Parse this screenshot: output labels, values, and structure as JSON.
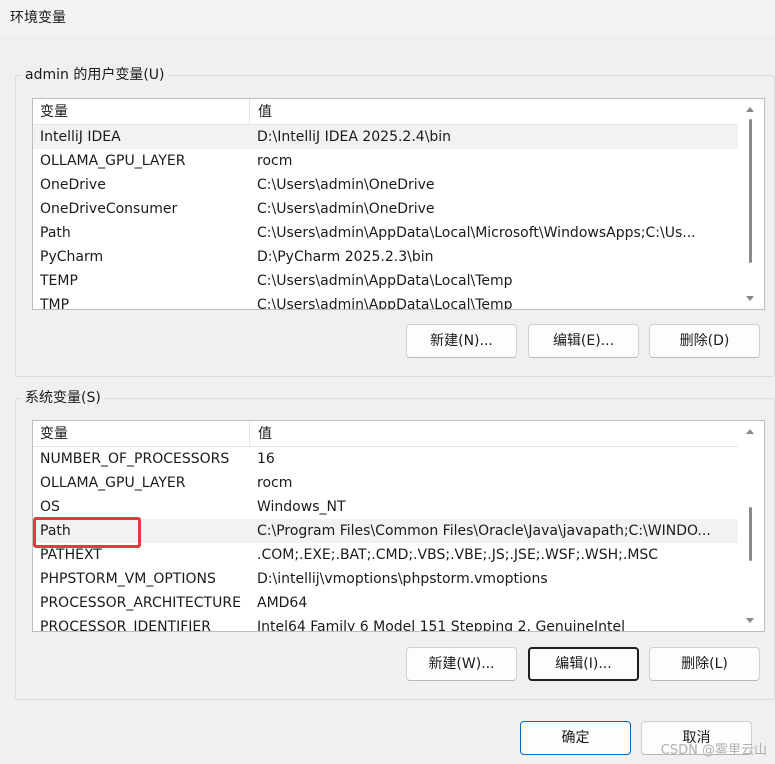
{
  "window": {
    "title": "环境变量"
  },
  "user_vars": {
    "legend": "admin 的用户变量(U)",
    "header": {
      "name": "变量",
      "value": "值"
    },
    "rows": [
      {
        "name": "IntelliJ IDEA",
        "value": "D:\\IntelliJ IDEA 2025.2.4\\bin",
        "selected": true
      },
      {
        "name": "OLLAMA_GPU_LAYER",
        "value": "rocm"
      },
      {
        "name": "OneDrive",
        "value": "C:\\Users\\admin\\OneDrive"
      },
      {
        "name": "OneDriveConsumer",
        "value": "C:\\Users\\admin\\OneDrive"
      },
      {
        "name": "Path",
        "value": "C:\\Users\\admin\\AppData\\Local\\Microsoft\\WindowsApps;C:\\Us..."
      },
      {
        "name": "PyCharm",
        "value": "D:\\PyCharm 2025.2.3\\bin"
      },
      {
        "name": "TEMP",
        "value": "C:\\Users\\admin\\AppData\\Local\\Temp"
      },
      {
        "name": "TMP",
        "value": "C:\\Users\\admin\\AppData\\Local\\Temp"
      }
    ],
    "buttons": {
      "new": "新建(N)...",
      "edit": "编辑(E)...",
      "delete": "删除(D)"
    }
  },
  "system_vars": {
    "legend": "系统变量(S)",
    "header": {
      "name": "变量",
      "value": "值"
    },
    "rows": [
      {
        "name": "NUMBER_OF_PROCESSORS",
        "value": "16"
      },
      {
        "name": "OLLAMA_GPU_LAYER",
        "value": "rocm"
      },
      {
        "name": "OS",
        "value": "Windows_NT"
      },
      {
        "name": "Path",
        "value": "C:\\Program Files\\Common Files\\Oracle\\Java\\javapath;C:\\WINDO...",
        "selected": true,
        "highlighted": true
      },
      {
        "name": "PATHEXT",
        "value": ".COM;.EXE;.BAT;.CMD;.VBS;.VBE;.JS;.JSE;.WSF;.WSH;.MSC"
      },
      {
        "name": "PHPSTORM_VM_OPTIONS",
        "value": "D:\\intellij\\vmoptions\\phpstorm.vmoptions"
      },
      {
        "name": "PROCESSOR_ARCHITECTURE",
        "value": "AMD64"
      },
      {
        "name": "PROCESSOR_IDENTIFIER",
        "value": "Intel64 Family 6 Model 151 Stepping 2, GenuineIntel"
      }
    ],
    "buttons": {
      "new": "新建(W)...",
      "edit": "编辑(I)...",
      "delete": "删除(L)"
    }
  },
  "footer": {
    "ok": "确定",
    "cancel": "取消"
  },
  "watermark": "CSDN @雾里云山",
  "colors": {
    "highlight": "#e23b3b",
    "primary_border": "#0067c0",
    "selected_row": "#f2f2f2"
  }
}
